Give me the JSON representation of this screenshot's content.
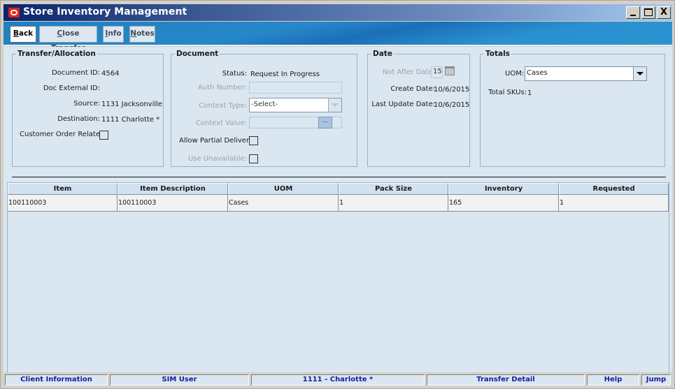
{
  "window": {
    "title": "Store Inventory Management",
    "controls": {
      "minimize": "_",
      "maximize": "□",
      "close": "X"
    }
  },
  "toolbar": {
    "back": {
      "mnemonic": "B",
      "rest": "ack"
    },
    "close_transfer": {
      "mnemonic": "C",
      "rest": "lose Transfer"
    },
    "info": {
      "mnemonic": "I",
      "rest": "nfo"
    },
    "notes": {
      "mnemonic": "N",
      "rest": "otes"
    }
  },
  "transfer_allocation": {
    "legend": "Transfer/Allocation",
    "document_id_label": "Document ID:",
    "document_id": "4564",
    "doc_external_id_label": "Doc External ID:",
    "doc_external_id": "",
    "source_label": "Source:",
    "source": "1131 Jacksonville",
    "destination_label": "Destination:",
    "destination": "1111 Charlotte *",
    "customer_order_related_label": "Customer Order Related:",
    "customer_order_related": false
  },
  "document": {
    "legend": "Document",
    "status_label": "Status:",
    "status": "Request In Progress",
    "auth_number_label": "Auth Number:",
    "auth_number": "",
    "context_type_label": "Context Type:",
    "context_type": "-Select-",
    "context_value_label": "Context Value:",
    "context_value": "",
    "context_value_button": "...",
    "allow_partial_delivery_label": "Allow Partial Delivery:",
    "allow_partial_delivery": false,
    "use_unavailable_label": "Use Unavailable:",
    "use_unavailable": false
  },
  "date": {
    "legend": "Date",
    "not_after_date_label": "Not After Date:",
    "not_after_date": "15",
    "create_date_label": "Create Date:",
    "create_date": "10/6/2015",
    "last_update_date_label": "Last Update Date:",
    "last_update_date": "10/6/2015"
  },
  "totals": {
    "legend": "Totals",
    "uom_label": "UOM:",
    "uom": "Cases",
    "total_skus_label": "Total SKUs:",
    "total_skus": "1"
  },
  "table": {
    "columns": [
      "Item",
      "Item Description",
      "UOM",
      "Pack Size",
      "Inventory",
      "Requested"
    ],
    "rows": [
      [
        "100110003",
        "100110003",
        "Cases",
        "1",
        "165",
        "1"
      ]
    ]
  },
  "statusbar": {
    "items": [
      "Client Information",
      "SIM User",
      "1111 - Charlotte *",
      "Transfer Detail",
      "Help",
      "Jump"
    ]
  },
  "colors": {
    "status_text": "#1a1aa0",
    "panel_bg": "#dae6f0",
    "oracle_red": "#e2231a"
  }
}
